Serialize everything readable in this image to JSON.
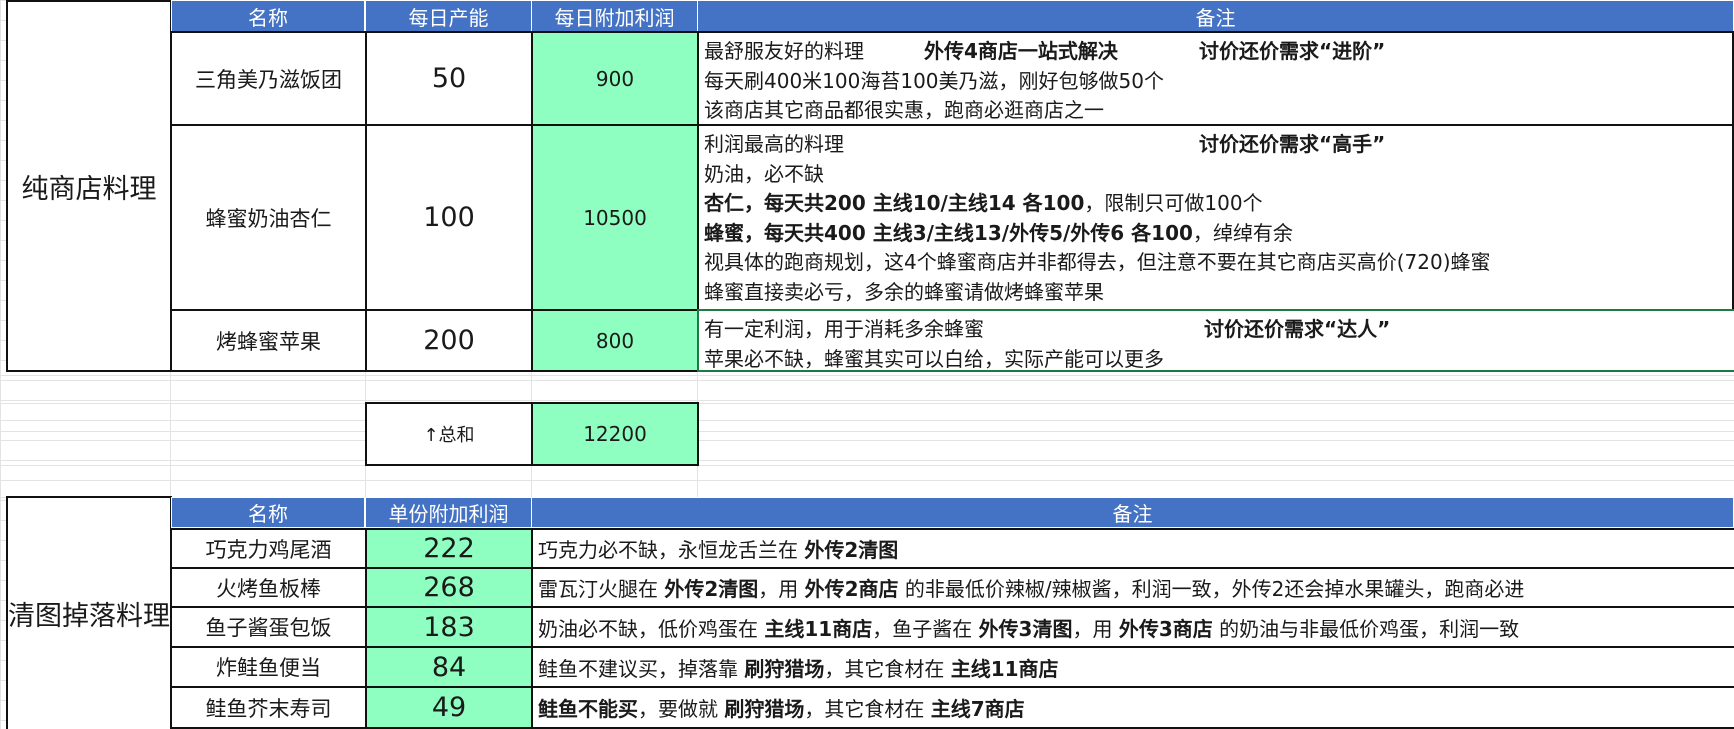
{
  "section1": {
    "group_label": "纯商店料理",
    "headers": {
      "name": "名称",
      "capacity": "每日产能",
      "profit": "每日附加利润",
      "note": "备注"
    },
    "rows": [
      {
        "name": "三角美乃滋饭团",
        "capacity": "50",
        "profit": "900",
        "notes": [
          {
            "a": "最舒服友好的料理",
            "b": "外传4商店一站式解决",
            "c": "讨价还价需求“进阶”"
          },
          {
            "a": "每天刷400米100海苔100美乃滋，刚好包够做50个"
          },
          {
            "a": "该商店其它商品都很实惠，跑商必逛商店之一"
          }
        ]
      },
      {
        "name": "蜂蜜奶油杏仁",
        "capacity": "100",
        "profit": "10500",
        "notes": [
          {
            "a": "利润最高的料理",
            "c": "讨价还价需求“高手”"
          },
          {
            "a": "奶油，必不缺"
          },
          {
            "bold": "杏仁，每天共200  主线10/主线14 各100",
            "rest": "，限制只可做100个"
          },
          {
            "bold": "蜂蜜，每天共400  主线3/主线13/外传5/外传6 各100",
            "rest": "，绰绰有余"
          },
          {
            "a": "视具体的跑商规划，这4个蜂蜜商店并非都得去，但注意不要在其它商店买高价(720)蜂蜜"
          },
          {
            "a": "蜂蜜直接卖必亏，多余的蜂蜜请做烤蜂蜜苹果"
          }
        ]
      },
      {
        "name": "烤蜂蜜苹果",
        "capacity": "200",
        "profit": "800",
        "notes": [
          {
            "a": "有一定利润，用于消耗多余蜂蜜",
            "c": "讨价还价需求“达人”"
          },
          {
            "a": "苹果必不缺，蜂蜜其实可以白给，实际产能可以更多"
          }
        ]
      }
    ],
    "total_label": "↑总和",
    "total_value": "12200"
  },
  "section2": {
    "group_label": "清图掉落料理",
    "headers": {
      "name": "名称",
      "profit": "单份附加利润",
      "note": "备注"
    },
    "rows": [
      {
        "name": "巧克力鸡尾酒",
        "profit": "222",
        "parts": [
          {
            "t": "巧克力必不缺，永恒龙舌兰在 "
          },
          {
            "t": "外传2清图",
            "b": true
          }
        ]
      },
      {
        "name": "火烤鱼板棒",
        "profit": "268",
        "parts": [
          {
            "t": "雷瓦汀火腿在 "
          },
          {
            "t": "外传2清图",
            "b": true
          },
          {
            "t": "，用 "
          },
          {
            "t": "外传2商店",
            "b": true
          },
          {
            "t": " 的非最低价辣椒/辣椒酱，利润一致，外传2还会掉水果罐头，跑商必进"
          }
        ]
      },
      {
        "name": "鱼子酱蛋包饭",
        "profit": "183",
        "parts": [
          {
            "t": "奶油必不缺，低价鸡蛋在 "
          },
          {
            "t": "主线11商店",
            "b": true
          },
          {
            "t": "，鱼子酱在 "
          },
          {
            "t": "外传3清图",
            "b": true
          },
          {
            "t": "，用 "
          },
          {
            "t": "外传3商店",
            "b": true
          },
          {
            "t": " 的奶油与非最低价鸡蛋，利润一致"
          }
        ]
      },
      {
        "name": "炸鲑鱼便当",
        "profit": "84",
        "parts": [
          {
            "t": "鲑鱼不建议买，掉落靠 "
          },
          {
            "t": "刷狩猎场",
            "b": true
          },
          {
            "t": "，其它食材在 "
          },
          {
            "t": "主线11商店",
            "b": true
          }
        ]
      },
      {
        "name": "鲑鱼芥末寿司",
        "profit": "49",
        "parts": [
          {
            "t": "鲑鱼不能买",
            "b": true
          },
          {
            "t": "，要做就 "
          },
          {
            "t": "刷狩猎场",
            "b": true
          },
          {
            "t": "，其它食材在 "
          },
          {
            "t": "主线7商店",
            "b": true
          }
        ]
      }
    ]
  },
  "colors": {
    "header": "#4472c4",
    "profit_fill": "#8effc1",
    "gridline": "#e3e3e3"
  }
}
